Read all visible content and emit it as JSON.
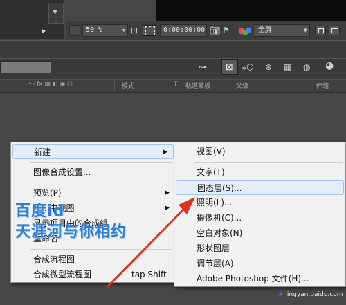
{
  "viewer": {
    "zoom": "50 %",
    "timecode": "0:00:00:00",
    "resolution": "全屏"
  },
  "timeline": {
    "headers": {
      "switches": "-* ⁄ fx ▦ ◐ ◉ ⬡",
      "mode": "模式",
      "t": "T",
      "track_matte": "轨道蒙板",
      "parent": "父级",
      "stretch": "伸缩"
    }
  },
  "context_menu": {
    "items": [
      {
        "label": "新建",
        "submenu": true
      },
      {
        "label": "图像合成设置..."
      },
      {
        "label": "预览(P)",
        "submenu": true
      },
      {
        "label": "在...中视图",
        "submenu": true
      },
      {
        "label": "显示项目中的合成组"
      },
      {
        "label": "重命名"
      },
      {
        "label": "合成流程图"
      },
      {
        "label": "合成微型流程图",
        "shortcut": "tap Shift"
      }
    ]
  },
  "submenu_new": {
    "items": [
      {
        "label": "视图(V)"
      },
      {
        "label": "文字(T)"
      },
      {
        "label": "固态层(S)..."
      },
      {
        "label": "照明(L)..."
      },
      {
        "label": "摄像机(C)..."
      },
      {
        "label": "空白对象(N)"
      },
      {
        "label": "形状图层"
      },
      {
        "label": "调节层(A)"
      },
      {
        "label": "Adobe Photoshop 文件(H)..."
      }
    ]
  },
  "watermark": {
    "line1": "百度id",
    "line2": "天涯河与你相约",
    "site": "jingyan.baidu.com"
  },
  "colors": {
    "highlight": "#e4eefb",
    "arrow": "#e0301e",
    "watermark": "#2c7dd6"
  }
}
